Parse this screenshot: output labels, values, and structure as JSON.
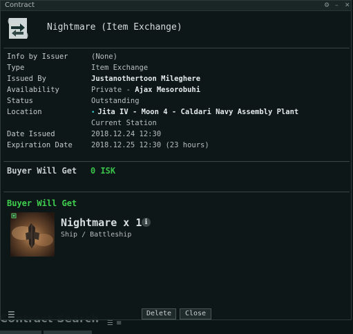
{
  "window": {
    "title": "Contract",
    "heading": "Nightmare (Item Exchange)"
  },
  "details": [
    {
      "label": "Info by Issuer",
      "value": "(None)"
    },
    {
      "label": "Type",
      "value": "Item Exchange"
    },
    {
      "label": "Issued By",
      "value": "Justanothertoon Mileghere"
    },
    {
      "label": "Availability",
      "value_prefix": "Private - ",
      "value": "Ajax Mesorobuhi"
    },
    {
      "label": "Status",
      "value": "Outstanding"
    },
    {
      "label": "Location",
      "value": "Jita IV - Moon 4 - Caldari Navy Assembly Plant"
    },
    {
      "label": "",
      "value": "Current Station"
    },
    {
      "label": "Date Issued",
      "value": "2018.12.24 12:30"
    },
    {
      "label": "Expiration Date",
      "value": "2018.12.25 12:30 (23 hours)"
    }
  ],
  "buyer_price": {
    "label": "Buyer Will Get",
    "value": "0 ISK"
  },
  "items_section": {
    "heading": "Buyer Will Get",
    "items": [
      {
        "name": "Nightmare x 1",
        "category": "Ship / Battleship"
      }
    ]
  },
  "buttons": {
    "delete": "Delete",
    "close": "Close"
  },
  "background": {
    "window_title": "Contract Search"
  },
  "icons": {
    "titlebar": [
      "settings-icon",
      "minimize-icon",
      "close-icon"
    ],
    "header": "contract-exchange-icon",
    "location_marker": "security-status-dot",
    "menu": "hamburger-menu-icon"
  },
  "colors": {
    "accent_green": "#3fcf4e",
    "background": "#0c1516"
  }
}
